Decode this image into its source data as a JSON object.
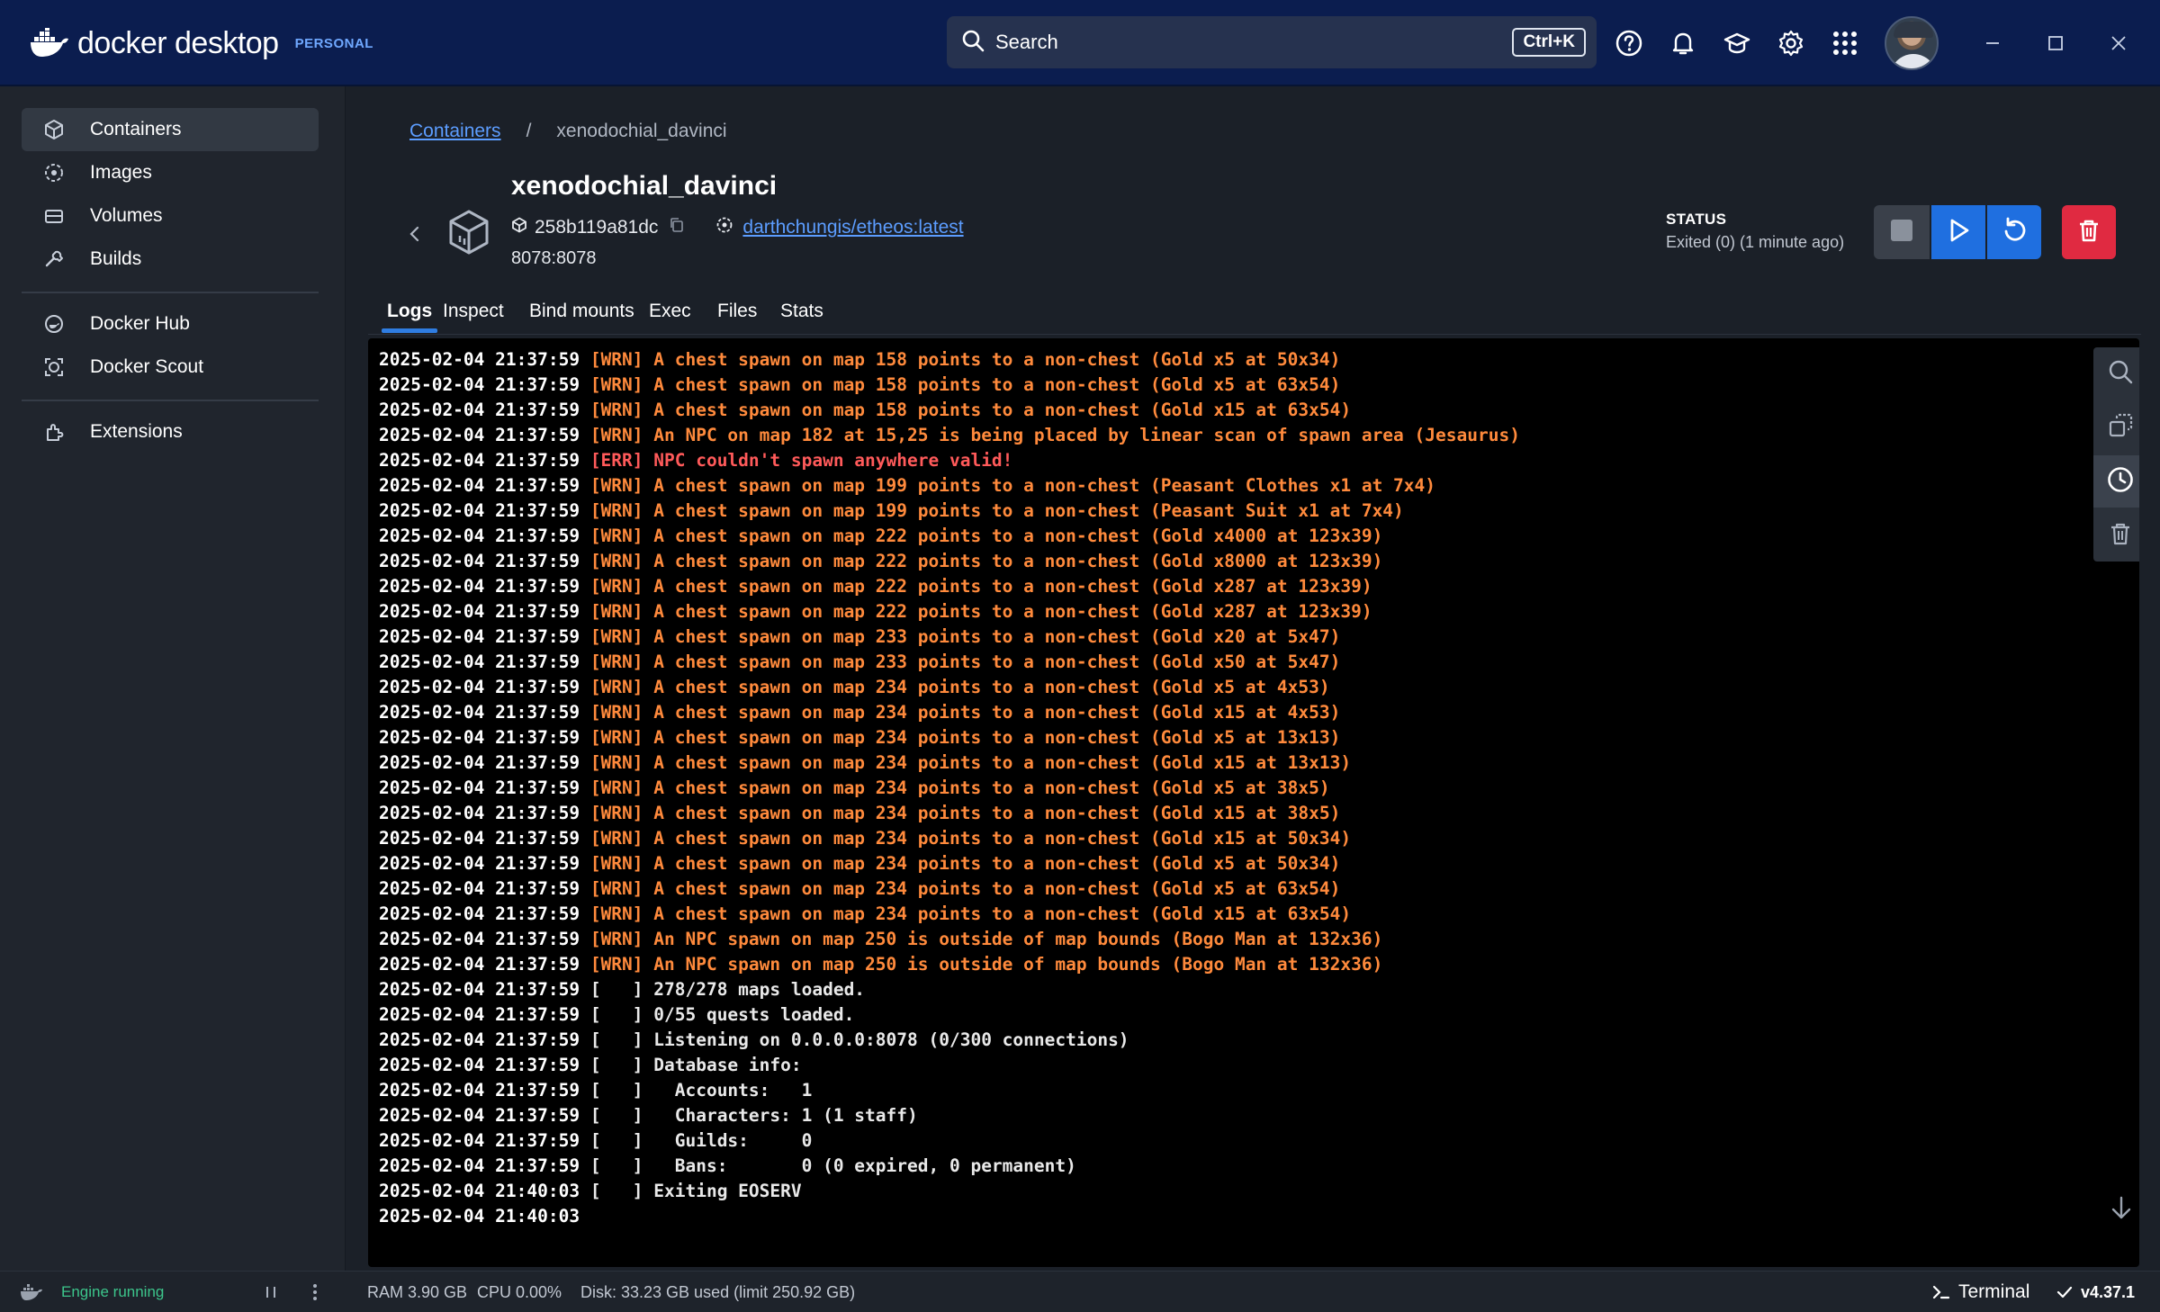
{
  "app": {
    "brand_name": "docker desktop",
    "edition": "PERSONAL"
  },
  "search": {
    "label": "Search",
    "shortcut": "Ctrl+K"
  },
  "sidebar": {
    "items": [
      {
        "label": "Containers",
        "icon": "containers-icon",
        "active": true
      },
      {
        "label": "Images",
        "icon": "images-icon"
      },
      {
        "label": "Volumes",
        "icon": "volumes-icon"
      },
      {
        "label": "Builds",
        "icon": "builds-icon"
      },
      {
        "label": "Docker Hub",
        "icon": "docker-hub-icon"
      },
      {
        "label": "Docker Scout",
        "icon": "docker-scout-icon"
      },
      {
        "label": "Extensions",
        "icon": "extensions-icon"
      }
    ]
  },
  "breadcrumb": {
    "parent": "Containers",
    "separator": "/",
    "current": "xenodochial_davinci"
  },
  "container": {
    "name": "xenodochial_davinci",
    "id": "258b119a81dc",
    "image": "darthchungis/etheos:latest",
    "ports": "8078:8078",
    "status_label": "STATUS",
    "status_value": "Exited (0) (1 minute ago)"
  },
  "tabs": [
    "Logs",
    "Inspect",
    "Bind mounts",
    "Exec",
    "Files",
    "Stats"
  ],
  "active_tab": "Logs",
  "logs": [
    {
      "ts": "2025-02-04 21:37:59",
      "level": "wrn",
      "msg": "[WRN] A chest spawn on map 158 points to a non-chest (Gold x5 at 50x34)"
    },
    {
      "ts": "2025-02-04 21:37:59",
      "level": "wrn",
      "msg": "[WRN] A chest spawn on map 158 points to a non-chest (Gold x5 at 63x54)"
    },
    {
      "ts": "2025-02-04 21:37:59",
      "level": "wrn",
      "msg": "[WRN] A chest spawn on map 158 points to a non-chest (Gold x15 at 63x54)"
    },
    {
      "ts": "2025-02-04 21:37:59",
      "level": "wrn",
      "msg": "[WRN] An NPC on map 182 at 15,25 is being placed by linear scan of spawn area (Jesaurus)"
    },
    {
      "ts": "2025-02-04 21:37:59",
      "level": "err",
      "msg": "[ERR] NPC couldn't spawn anywhere valid!"
    },
    {
      "ts": "2025-02-04 21:37:59",
      "level": "wrn",
      "msg": "[WRN] A chest spawn on map 199 points to a non-chest (Peasant Clothes x1 at 7x4)"
    },
    {
      "ts": "2025-02-04 21:37:59",
      "level": "wrn",
      "msg": "[WRN] A chest spawn on map 199 points to a non-chest (Peasant Suit x1 at 7x4)"
    },
    {
      "ts": "2025-02-04 21:37:59",
      "level": "wrn",
      "msg": "[WRN] A chest spawn on map 222 points to a non-chest (Gold x4000 at 123x39)"
    },
    {
      "ts": "2025-02-04 21:37:59",
      "level": "wrn",
      "msg": "[WRN] A chest spawn on map 222 points to a non-chest (Gold x8000 at 123x39)"
    },
    {
      "ts": "2025-02-04 21:37:59",
      "level": "wrn",
      "msg": "[WRN] A chest spawn on map 222 points to a non-chest (Gold x287 at 123x39)"
    },
    {
      "ts": "2025-02-04 21:37:59",
      "level": "wrn",
      "msg": "[WRN] A chest spawn on map 222 points to a non-chest (Gold x287 at 123x39)"
    },
    {
      "ts": "2025-02-04 21:37:59",
      "level": "wrn",
      "msg": "[WRN] A chest spawn on map 233 points to a non-chest (Gold x20 at 5x47)"
    },
    {
      "ts": "2025-02-04 21:37:59",
      "level": "wrn",
      "msg": "[WRN] A chest spawn on map 233 points to a non-chest (Gold x50 at 5x47)"
    },
    {
      "ts": "2025-02-04 21:37:59",
      "level": "wrn",
      "msg": "[WRN] A chest spawn on map 234 points to a non-chest (Gold x5 at 4x53)"
    },
    {
      "ts": "2025-02-04 21:37:59",
      "level": "wrn",
      "msg": "[WRN] A chest spawn on map 234 points to a non-chest (Gold x15 at 4x53)"
    },
    {
      "ts": "2025-02-04 21:37:59",
      "level": "wrn",
      "msg": "[WRN] A chest spawn on map 234 points to a non-chest (Gold x5 at 13x13)"
    },
    {
      "ts": "2025-02-04 21:37:59",
      "level": "wrn",
      "msg": "[WRN] A chest spawn on map 234 points to a non-chest (Gold x15 at 13x13)"
    },
    {
      "ts": "2025-02-04 21:37:59",
      "level": "wrn",
      "msg": "[WRN] A chest spawn on map 234 points to a non-chest (Gold x5 at 38x5)"
    },
    {
      "ts": "2025-02-04 21:37:59",
      "level": "wrn",
      "msg": "[WRN] A chest spawn on map 234 points to a non-chest (Gold x15 at 38x5)"
    },
    {
      "ts": "2025-02-04 21:37:59",
      "level": "wrn",
      "msg": "[WRN] A chest spawn on map 234 points to a non-chest (Gold x15 at 50x34)"
    },
    {
      "ts": "2025-02-04 21:37:59",
      "level": "wrn",
      "msg": "[WRN] A chest spawn on map 234 points to a non-chest (Gold x5 at 50x34)"
    },
    {
      "ts": "2025-02-04 21:37:59",
      "level": "wrn",
      "msg": "[WRN] A chest spawn on map 234 points to a non-chest (Gold x5 at 63x54)"
    },
    {
      "ts": "2025-02-04 21:37:59",
      "level": "wrn",
      "msg": "[WRN] A chest spawn on map 234 points to a non-chest (Gold x15 at 63x54)"
    },
    {
      "ts": "2025-02-04 21:37:59",
      "level": "wrn",
      "msg": "[WRN] An NPC spawn on map 250 is outside of map bounds (Bogo Man at 132x36)"
    },
    {
      "ts": "2025-02-04 21:37:59",
      "level": "wrn",
      "msg": "[WRN] An NPC spawn on map 250 is outside of map bounds (Bogo Man at 132x36)"
    },
    {
      "ts": "2025-02-04 21:37:59",
      "level": "inf",
      "msg": "[   ] 278/278 maps loaded."
    },
    {
      "ts": "2025-02-04 21:37:59",
      "level": "inf",
      "msg": "[   ] 0/55 quests loaded."
    },
    {
      "ts": "2025-02-04 21:37:59",
      "level": "inf",
      "msg": "[   ] Listening on 0.0.0.0:8078 (0/300 connections)"
    },
    {
      "ts": "2025-02-04 21:37:59",
      "level": "inf",
      "msg": "[   ] Database info:"
    },
    {
      "ts": "2025-02-04 21:37:59",
      "level": "inf",
      "msg": "[   ]   Accounts:   1"
    },
    {
      "ts": "2025-02-04 21:37:59",
      "level": "inf",
      "msg": "[   ]   Characters: 1 (1 staff)"
    },
    {
      "ts": "2025-02-04 21:37:59",
      "level": "inf",
      "msg": "[   ]   Guilds:     0"
    },
    {
      "ts": "2025-02-04 21:37:59",
      "level": "inf",
      "msg": "[   ]   Bans:       0 (0 expired, 0 permanent)"
    },
    {
      "ts": "2025-02-04 21:40:03",
      "level": "inf",
      "msg": "[   ] Exiting EOSERV"
    },
    {
      "ts": "2025-02-04 21:40:03",
      "level": "inf",
      "msg": ""
    }
  ],
  "footer": {
    "engine_status": "Engine running",
    "ram": "RAM 3.90 GB",
    "cpu": "CPU 0.00%",
    "disk": "Disk: 33.23 GB used (limit 250.92 GB)",
    "terminal": "Terminal",
    "version": "v4.37.1"
  },
  "colors": {
    "accent": "#2f7de1",
    "warn": "#ff8a3c",
    "error": "#ff5a5a",
    "delete": "#e02a41",
    "engine": "#3cc58b",
    "titlebar": "#0b1d4f"
  }
}
